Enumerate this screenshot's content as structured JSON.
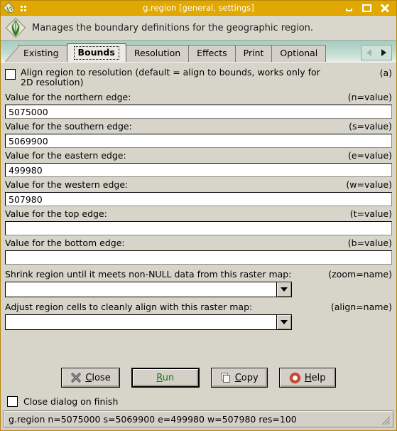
{
  "titlebar": {
    "title": "g.region [general, settings]",
    "app_icon": "grass-app-icon",
    "menu_icon": "grid-menu-icon",
    "minimize_label": "Minimize",
    "maximize_label": "Maximize",
    "close_label": "Close"
  },
  "header": {
    "logo": "grass-logo-icon",
    "description": "Manages the boundary definitions for the geographic region."
  },
  "tabs": {
    "items": [
      {
        "label": "Existing",
        "active": false
      },
      {
        "label": "Bounds",
        "active": true
      },
      {
        "label": "Resolution",
        "active": false
      },
      {
        "label": "Effects",
        "active": false
      },
      {
        "label": "Print",
        "active": false
      },
      {
        "label": "Optional",
        "active": false
      }
    ],
    "scroll_left_icon": "triangle-left-icon",
    "scroll_right_icon": "triangle-right-icon"
  },
  "panel": {
    "align_checkbox": {
      "label": "Align region to resolution (default = align to bounds, works only for 2D resolution)",
      "hint": "(a)",
      "checked": false
    },
    "fields": [
      {
        "label": "Value for the northern edge:",
        "hint": "(n=value)",
        "value": "5075000",
        "name": "northern-edge"
      },
      {
        "label": "Value for the southern edge:",
        "hint": "(s=value)",
        "value": "5069900",
        "name": "southern-edge"
      },
      {
        "label": "Value for the eastern edge:",
        "hint": "(e=value)",
        "value": "499980",
        "name": "eastern-edge"
      },
      {
        "label": "Value for the western edge:",
        "hint": "(w=value)",
        "value": "507980",
        "name": "western-edge"
      },
      {
        "label": "Value for the top edge:",
        "hint": "(t=value)",
        "value": "",
        "name": "top-edge"
      },
      {
        "label": "Value for the bottom edge:",
        "hint": "(b=value)",
        "value": "",
        "name": "bottom-edge"
      }
    ],
    "combos": [
      {
        "label": "Shrink region until it meets non-NULL data from this raster map:",
        "hint": "(zoom=name)",
        "value": "",
        "name": "zoom-raster-map"
      },
      {
        "label": "Adjust region cells to cleanly align with this raster map:",
        "hint": "(align=name)",
        "value": "",
        "name": "align-raster-map"
      }
    ]
  },
  "buttons": {
    "close": {
      "label_before": "C",
      "label_key": "C",
      "label": "Close",
      "icon": "close-x-icon"
    },
    "run": {
      "label": "Run",
      "icon": "none",
      "is_default": true
    },
    "copy": {
      "label": "Copy",
      "icon": "copy-icon"
    },
    "help": {
      "label": "Help",
      "icon": "lifebuoy-help-icon"
    }
  },
  "finish": {
    "label": "Close dialog on finish",
    "checked": false
  },
  "statusbar": {
    "text": "g.region n=5075000  s=5069900 e=499980 w=507980 res=100",
    "grip_icon": "resize-grip-icon"
  },
  "colors": {
    "titlebar": "#e0a800",
    "panel": "#d7d4ca",
    "tabstrip_top": "#a9ccc0",
    "run_text": "#117a11",
    "help_accent": "#d93b3b"
  }
}
